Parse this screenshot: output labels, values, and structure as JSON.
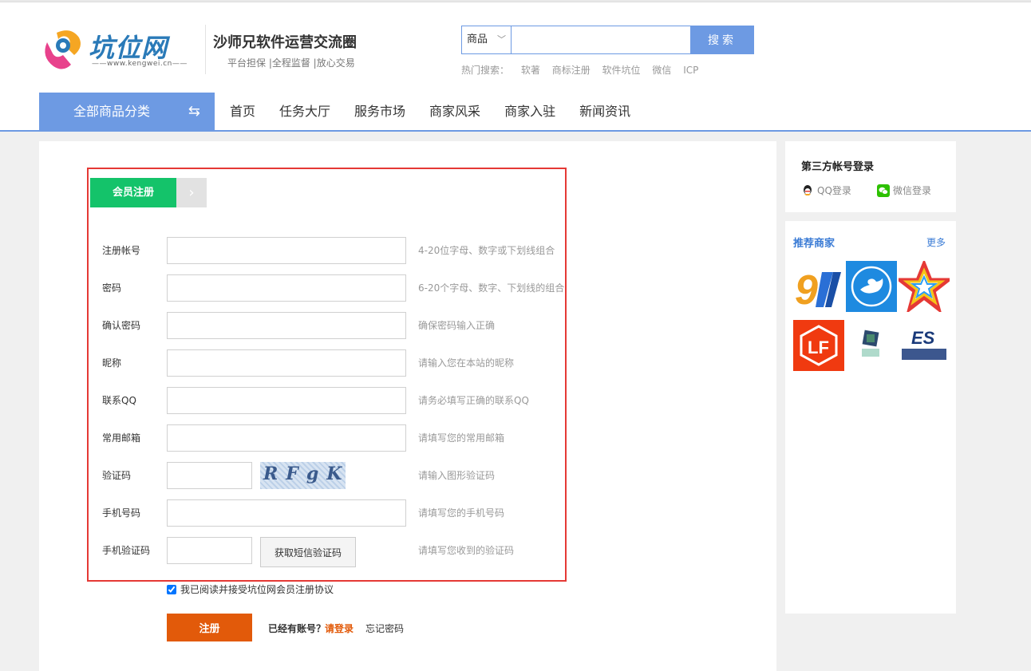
{
  "header": {
    "logo_text": "坑位网",
    "logo_url": "——www.kengwei.cn——",
    "slogan_title": "沙师兄软件运营交流圈",
    "slogan_sub": "平台担保 |全程监督 |放心交易"
  },
  "search": {
    "category": "商品",
    "placeholder": "",
    "button": "搜索",
    "hot_label": "热门搜索：",
    "hot_terms": [
      "软著",
      "商标注册",
      "软件坑位",
      "微信",
      "ICP"
    ]
  },
  "nav": {
    "category_label": "全部商品分类",
    "items": [
      "首页",
      "任务大厅",
      "服务市场",
      "商家风采",
      "商家入驻",
      "新闻资讯"
    ]
  },
  "register": {
    "tab_label": "会员注册",
    "fields": [
      {
        "label": "注册帐号",
        "hint": "4-20位字母、数字或下划线组合"
      },
      {
        "label": "密码",
        "hint": "6-20个字母、数字、下划线的组合"
      },
      {
        "label": "确认密码",
        "hint": "确保密码输入正确"
      },
      {
        "label": "昵称",
        "hint": "请输入您在本站的昵称"
      },
      {
        "label": "联系QQ",
        "hint": "请务必填写正确的联系QQ"
      },
      {
        "label": "常用邮箱",
        "hint": "请填写您的常用邮箱"
      },
      {
        "label": "验证码",
        "hint": "请输入图形验证码"
      },
      {
        "label": "手机号码",
        "hint": "请填写您的手机号码"
      },
      {
        "label": "手机验证码",
        "hint": "请填写您收到的验证码"
      }
    ],
    "captcha_text": "RFgK",
    "sms_button": "获取短信验证码",
    "agree_text": "我已阅读并接受坑位网会员注册协议",
    "agree_checked": true,
    "submit": "注册",
    "have_account": "已经有账号？",
    "login_link": "请登录",
    "forgot": "忘记密码"
  },
  "sidebar": {
    "third_party_title": "第三方帐号登录",
    "qq_login": "QQ登录",
    "wechat_login": "微信登录",
    "recommend_title": "推荐商家",
    "more": "更多"
  },
  "colors": {
    "accent": "#6d9ae3",
    "green_tab": "#14c36a",
    "submit": "#e25a0a",
    "frame": "#e53935"
  }
}
